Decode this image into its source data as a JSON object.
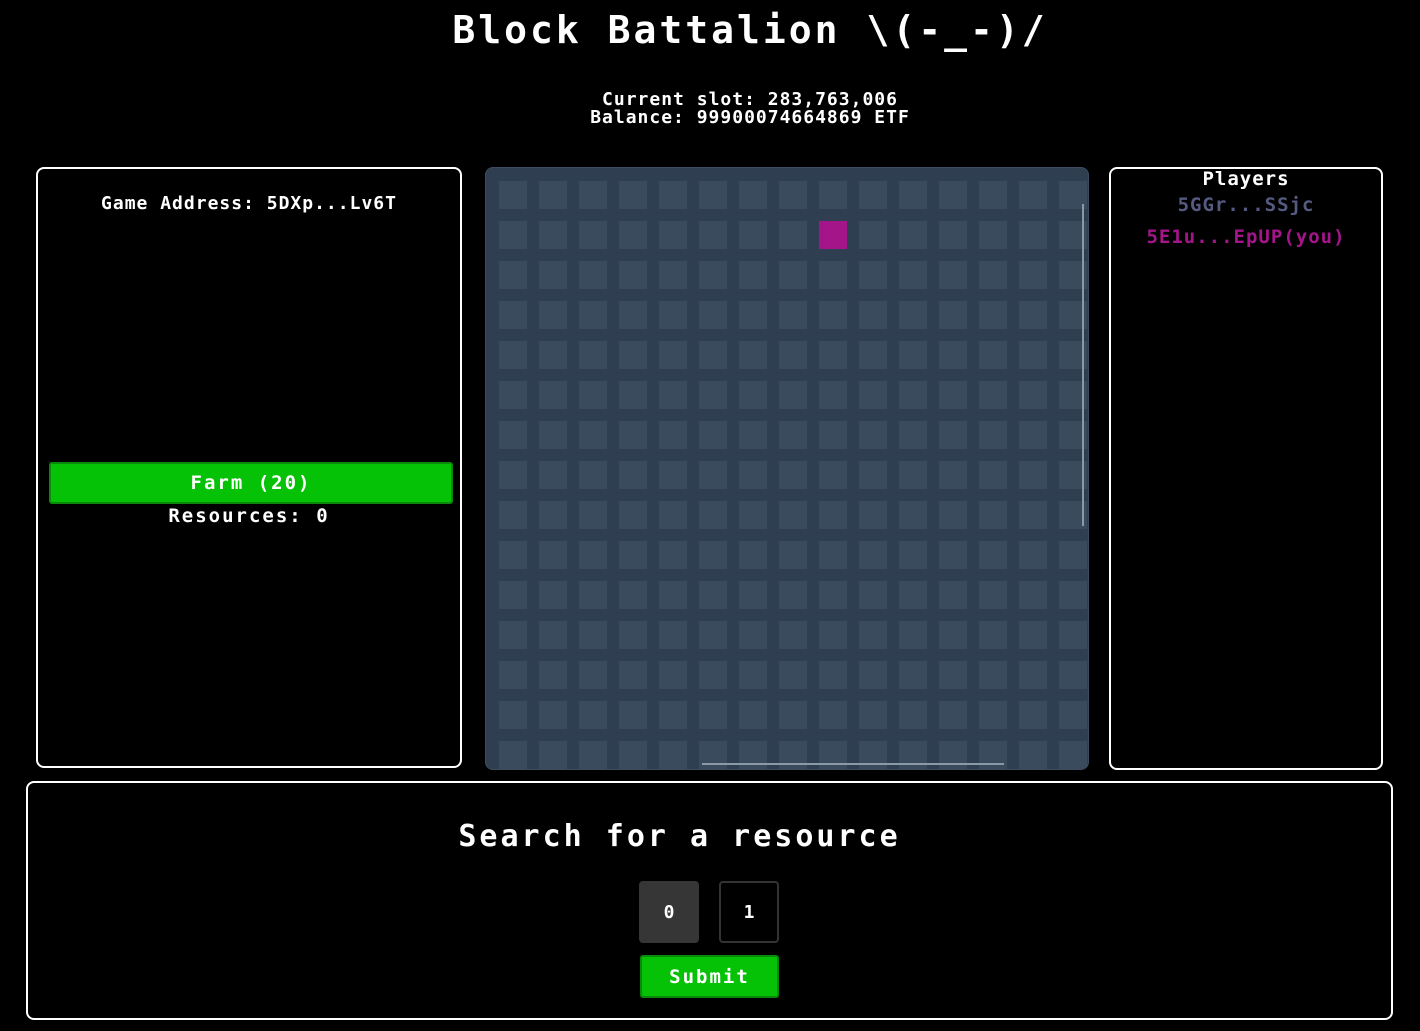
{
  "header": {
    "title": "Block Battalion \\(-_-)/",
    "current_slot": "Current slot: 283,763,006",
    "balance": "Balance: 99900074664869 ETF"
  },
  "left_panel": {
    "game_address": "Game Address: 5DXp...Lv6T",
    "farm_button": "Farm (20)",
    "resources": "Resources: 0"
  },
  "board": {
    "columns": 15,
    "visible_rows": 15,
    "owned_cell": {
      "row": 1,
      "col": 8
    },
    "colors": {
      "cell": "#3a4b5e",
      "owned": "#a4158a",
      "background": "#2f3e50"
    }
  },
  "players": {
    "title": "Players",
    "list": [
      {
        "address": "5GGr...SSjc",
        "is_you": false
      },
      {
        "address": "5E1u...EpUP(you)",
        "is_you": true
      }
    ]
  },
  "search": {
    "title": "Search for a resource",
    "options": [
      "0",
      "1"
    ],
    "selected": "0",
    "submit_label": "Submit"
  }
}
